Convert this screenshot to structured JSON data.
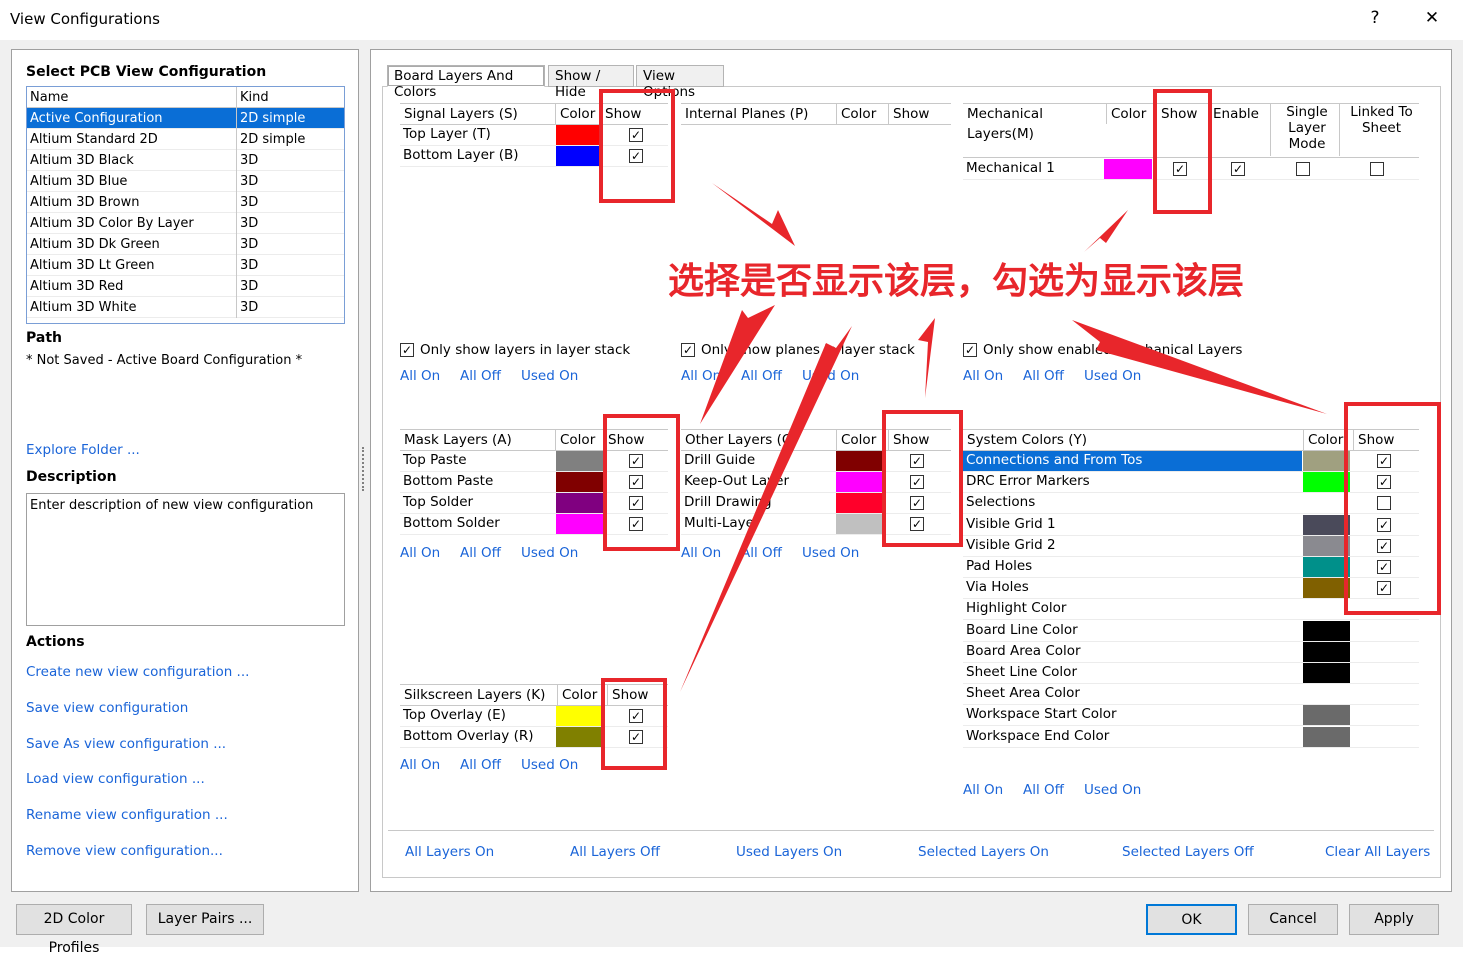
{
  "window": {
    "title": "View Configurations",
    "help": "?",
    "close": "✕"
  },
  "left": {
    "heading": "Select PCB View Configuration",
    "col_name": "Name",
    "col_kind": "Kind",
    "configs": [
      {
        "name": "Active Configuration",
        "kind": "2D simple"
      },
      {
        "name": "Altium Standard 2D",
        "kind": "2D simple"
      },
      {
        "name": "Altium 3D Black",
        "kind": "3D"
      },
      {
        "name": "Altium 3D Blue",
        "kind": "3D"
      },
      {
        "name": "Altium 3D Brown",
        "kind": "3D"
      },
      {
        "name": "Altium 3D Color By Layer",
        "kind": "3D"
      },
      {
        "name": "Altium 3D Dk Green",
        "kind": "3D"
      },
      {
        "name": "Altium 3D Lt Green",
        "kind": "3D"
      },
      {
        "name": "Altium 3D Red",
        "kind": "3D"
      },
      {
        "name": "Altium 3D White",
        "kind": "3D"
      }
    ],
    "path_label": "Path",
    "path_value": "* Not Saved - Active Board Configuration *",
    "explore": "Explore Folder ...",
    "desc_label": "Description",
    "desc_value": "Enter description of new view configuration",
    "actions_label": "Actions",
    "actions": [
      "Create new view configuration ...",
      "Save view configuration",
      "Save As view configuration ...",
      "Load view configuration ...",
      "Rename view configuration ...",
      "Remove view configuration..."
    ]
  },
  "tabs": [
    "Board Layers And Colors",
    "Show / Hide",
    "View Options"
  ],
  "common": {
    "color": "Color",
    "show": "Show",
    "all_on": "All On",
    "all_off": "All Off",
    "used_on": "Used On"
  },
  "signal": {
    "title": "Signal Layers (S)",
    "rows": [
      {
        "name": "Top Layer (T)",
        "color": "#ff0000"
      },
      {
        "name": "Bottom Layer (B)",
        "color": "#0000ff"
      }
    ],
    "only": "Only show layers in layer stack"
  },
  "planes": {
    "title": "Internal Planes (P)",
    "only": "Only show planes in layer stack"
  },
  "mech": {
    "title": "Mechanical Layers(M)",
    "enable": "Enable",
    "single": "Single Layer Mode",
    "linked": "Linked To Sheet",
    "rows": [
      {
        "name": "Mechanical 1",
        "color": "#ff00ff"
      }
    ],
    "only": "Only show enabled mechanical Layers"
  },
  "mask": {
    "title": "Mask Layers (A)",
    "rows": [
      {
        "name": "Top Paste",
        "color": "#808080"
      },
      {
        "name": "Bottom Paste",
        "color": "#800000"
      },
      {
        "name": "Top Solder",
        "color": "#800080"
      },
      {
        "name": "Bottom Solder",
        "color": "#ff00ff"
      }
    ]
  },
  "other": {
    "title": "Other Layers (O)",
    "rows": [
      {
        "name": "Drill Guide",
        "color": "#800000"
      },
      {
        "name": "Keep-Out Layer",
        "color": "#ff00ff"
      },
      {
        "name": "Drill Drawing",
        "color": "#ff002a"
      },
      {
        "name": "Multi-Layer",
        "color": "#c0c0c0"
      }
    ]
  },
  "silk": {
    "title": "Silkscreen Layers (K)",
    "rows": [
      {
        "name": "Top Overlay (E)",
        "color": "#ffff00"
      },
      {
        "name": "Bottom Overlay (R)",
        "color": "#808000"
      }
    ]
  },
  "sys": {
    "title": "System Colors (Y)",
    "rows": [
      {
        "name": "Connections and From Tos",
        "color": "#a0a080",
        "check": true
      },
      {
        "name": "DRC Error Markers",
        "color": "#00ff00",
        "check": true
      },
      {
        "name": "Selections",
        "color": "#ffffff",
        "check": false
      },
      {
        "name": "Visible Grid 1",
        "color": "#4a4a5a",
        "check": true
      },
      {
        "name": "Visible Grid 2",
        "color": "#8a8a90",
        "check": true
      },
      {
        "name": "Pad Holes",
        "color": "#00908a",
        "check": true
      },
      {
        "name": "Via Holes",
        "color": "#806000",
        "check": true
      },
      {
        "name": "Highlight Color",
        "color": "#ffffff",
        "check": null
      },
      {
        "name": "Board Line Color",
        "color": "#000000",
        "check": null
      },
      {
        "name": "Board Area Color",
        "color": "#000000",
        "check": null
      },
      {
        "name": "Sheet Line Color",
        "color": "#000000",
        "check": null
      },
      {
        "name": "Sheet Area Color",
        "color": "#ffffff",
        "check": null
      },
      {
        "name": "Workspace Start Color",
        "color": "#6a6a6a",
        "check": null
      },
      {
        "name": "Workspace End Color",
        "color": "#6a6a6a",
        "check": null
      }
    ]
  },
  "bottom_links": [
    "All Layers On",
    "All Layers Off",
    "Used Layers On",
    "Selected Layers On",
    "Selected Layers Off",
    "Clear All Layers"
  ],
  "buttons": {
    "profiles": "2D Color Profiles",
    "pairs": "Layer Pairs ...",
    "ok": "OK",
    "cancel": "Cancel",
    "apply": "Apply"
  },
  "annotation": "选择是否显示该层，勾选为显示该层",
  "colors": {
    "link": "#1a64d8",
    "highlight": "#e8262b",
    "select": "#0a6ed6"
  }
}
